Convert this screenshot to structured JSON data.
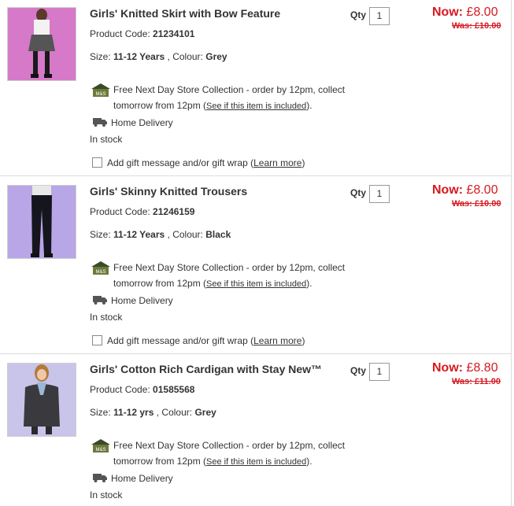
{
  "items": [
    {
      "title": "Girls' Knitted Skirt with Bow Feature",
      "code_label": "Product Code: ",
      "code": "21234101",
      "size_label": "Size: ",
      "size": "11-12 Years",
      "colour_label": " , Colour: ",
      "colour": "Grey",
      "collection_line1": "Free Next Day Store Collection - order by 12pm, collect",
      "collection_line2": "tomorrow from 12pm (",
      "collection_link": "See if this item is included",
      "collection_end": ").",
      "delivery": "Home Delivery",
      "stock": "In stock",
      "gift_label": "Add gift message and/or gift wrap (",
      "gift_link": "Learn more",
      "gift_end": ")",
      "qty_label": "Qty",
      "qty": "1",
      "now_label": "Now:",
      "now_price": " £8.00",
      "was_price": "Was: £10.00"
    },
    {
      "title": "Girls' Skinny Knitted Trousers",
      "code_label": "Product Code: ",
      "code": "21246159",
      "size_label": "Size: ",
      "size": "11-12 Years",
      "colour_label": " , Colour: ",
      "colour": "Black",
      "collection_line1": "Free Next Day Store Collection - order by 12pm, collect",
      "collection_line2": "tomorrow from 12pm (",
      "collection_link": "See if this item is included",
      "collection_end": ").",
      "delivery": "Home Delivery",
      "stock": "In stock",
      "gift_label": "Add gift message and/or gift wrap (",
      "gift_link": "Learn more",
      "gift_end": ")",
      "qty_label": "Qty",
      "qty": "1",
      "now_label": "Now:",
      "now_price": " £8.00",
      "was_price": "Was: £10.00"
    },
    {
      "title": "Girls' Cotton Rich Cardigan with Stay New™",
      "code_label": "Product Code: ",
      "code": "01585568",
      "size_label": "Size: ",
      "size": "11-12 yrs",
      "colour_label": " , Colour: ",
      "colour": "Grey",
      "collection_line1": "Free Next Day Store Collection - order by 12pm, collect",
      "collection_line2": "tomorrow from 12pm (",
      "collection_link": "See if this item is included",
      "collection_end": ").",
      "delivery": "Home Delivery",
      "stock": "In stock",
      "qty_label": "Qty",
      "qty": "1",
      "now_label": "Now:",
      "now_price": " £8.80",
      "was_price": "Was: £11.00"
    }
  ],
  "store_icon_text": "M&S",
  "colors": {
    "price": "#d6181f",
    "skirt_bg": "#d679c9",
    "trouser_bg": "#b8a6e6",
    "cardigan_bg": "#c8c4ea"
  }
}
